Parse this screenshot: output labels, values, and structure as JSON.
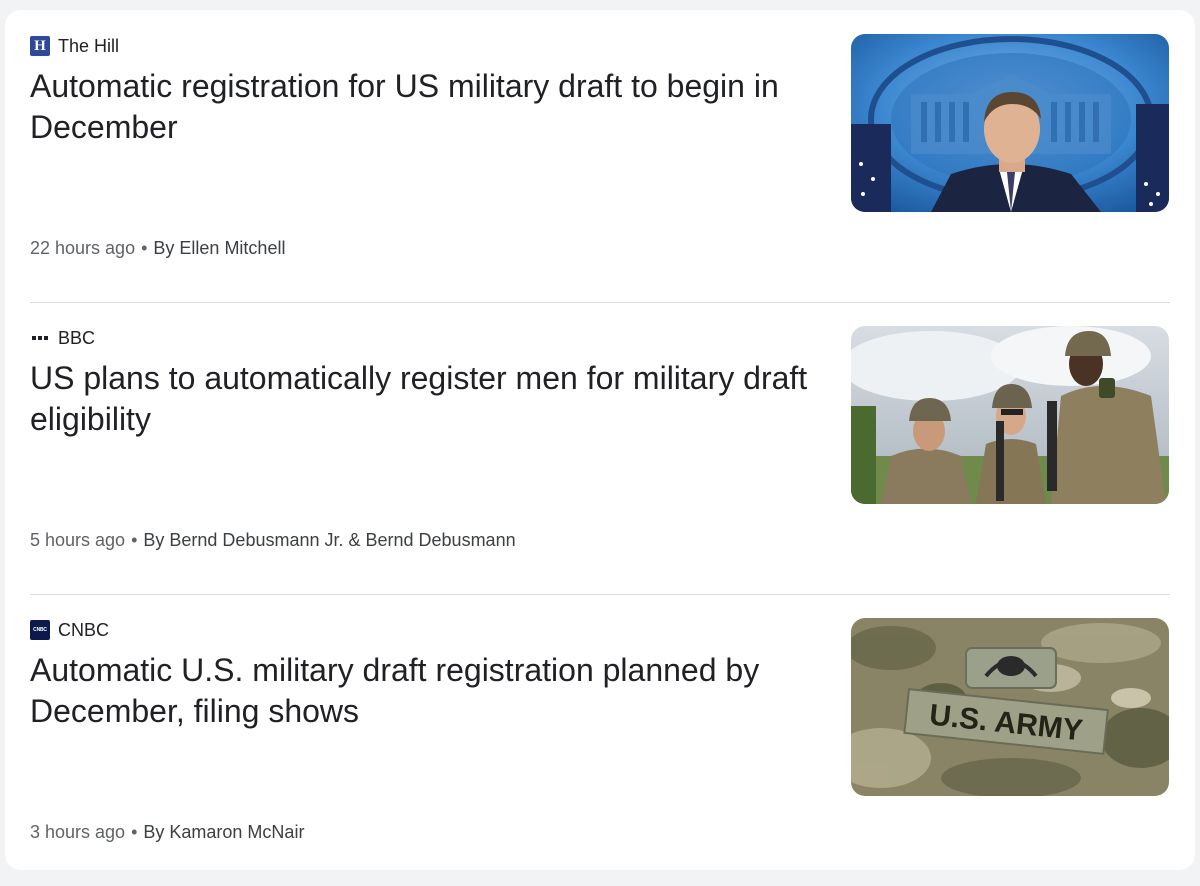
{
  "articles": [
    {
      "source": "The Hill",
      "logo_icon": "the-hill-logo",
      "logo_text": "H",
      "headline": "Automatic registration for US military draft to begin in December",
      "time": "22 hours ago",
      "separator": "•",
      "author": "By Ellen Mitchell",
      "image": "press-briefing-thumbnail"
    },
    {
      "source": "BBC",
      "logo_icon": "bbc-logo",
      "headline": "US plans to automatically register men for military draft eligibility",
      "time": "5 hours ago",
      "separator": "•",
      "author": "By Bernd Debusmann Jr. & Bernd Debusmann",
      "image": "soldiers-thumbnail"
    },
    {
      "source": "CNBC",
      "logo_icon": "cnbc-logo",
      "logo_text": "CNBC",
      "headline": "Automatic U.S. military draft registration planned by December, filing shows",
      "time": "3 hours ago",
      "separator": "•",
      "author": "By Kamaron McNair",
      "image": "us-army-patch-thumbnail",
      "image_text": "U.S. ARMY"
    }
  ],
  "colors": {
    "hill_blue": "#2d4a9a",
    "cnbc_navy": "#0b1a4a",
    "divider": "#dadce0"
  }
}
